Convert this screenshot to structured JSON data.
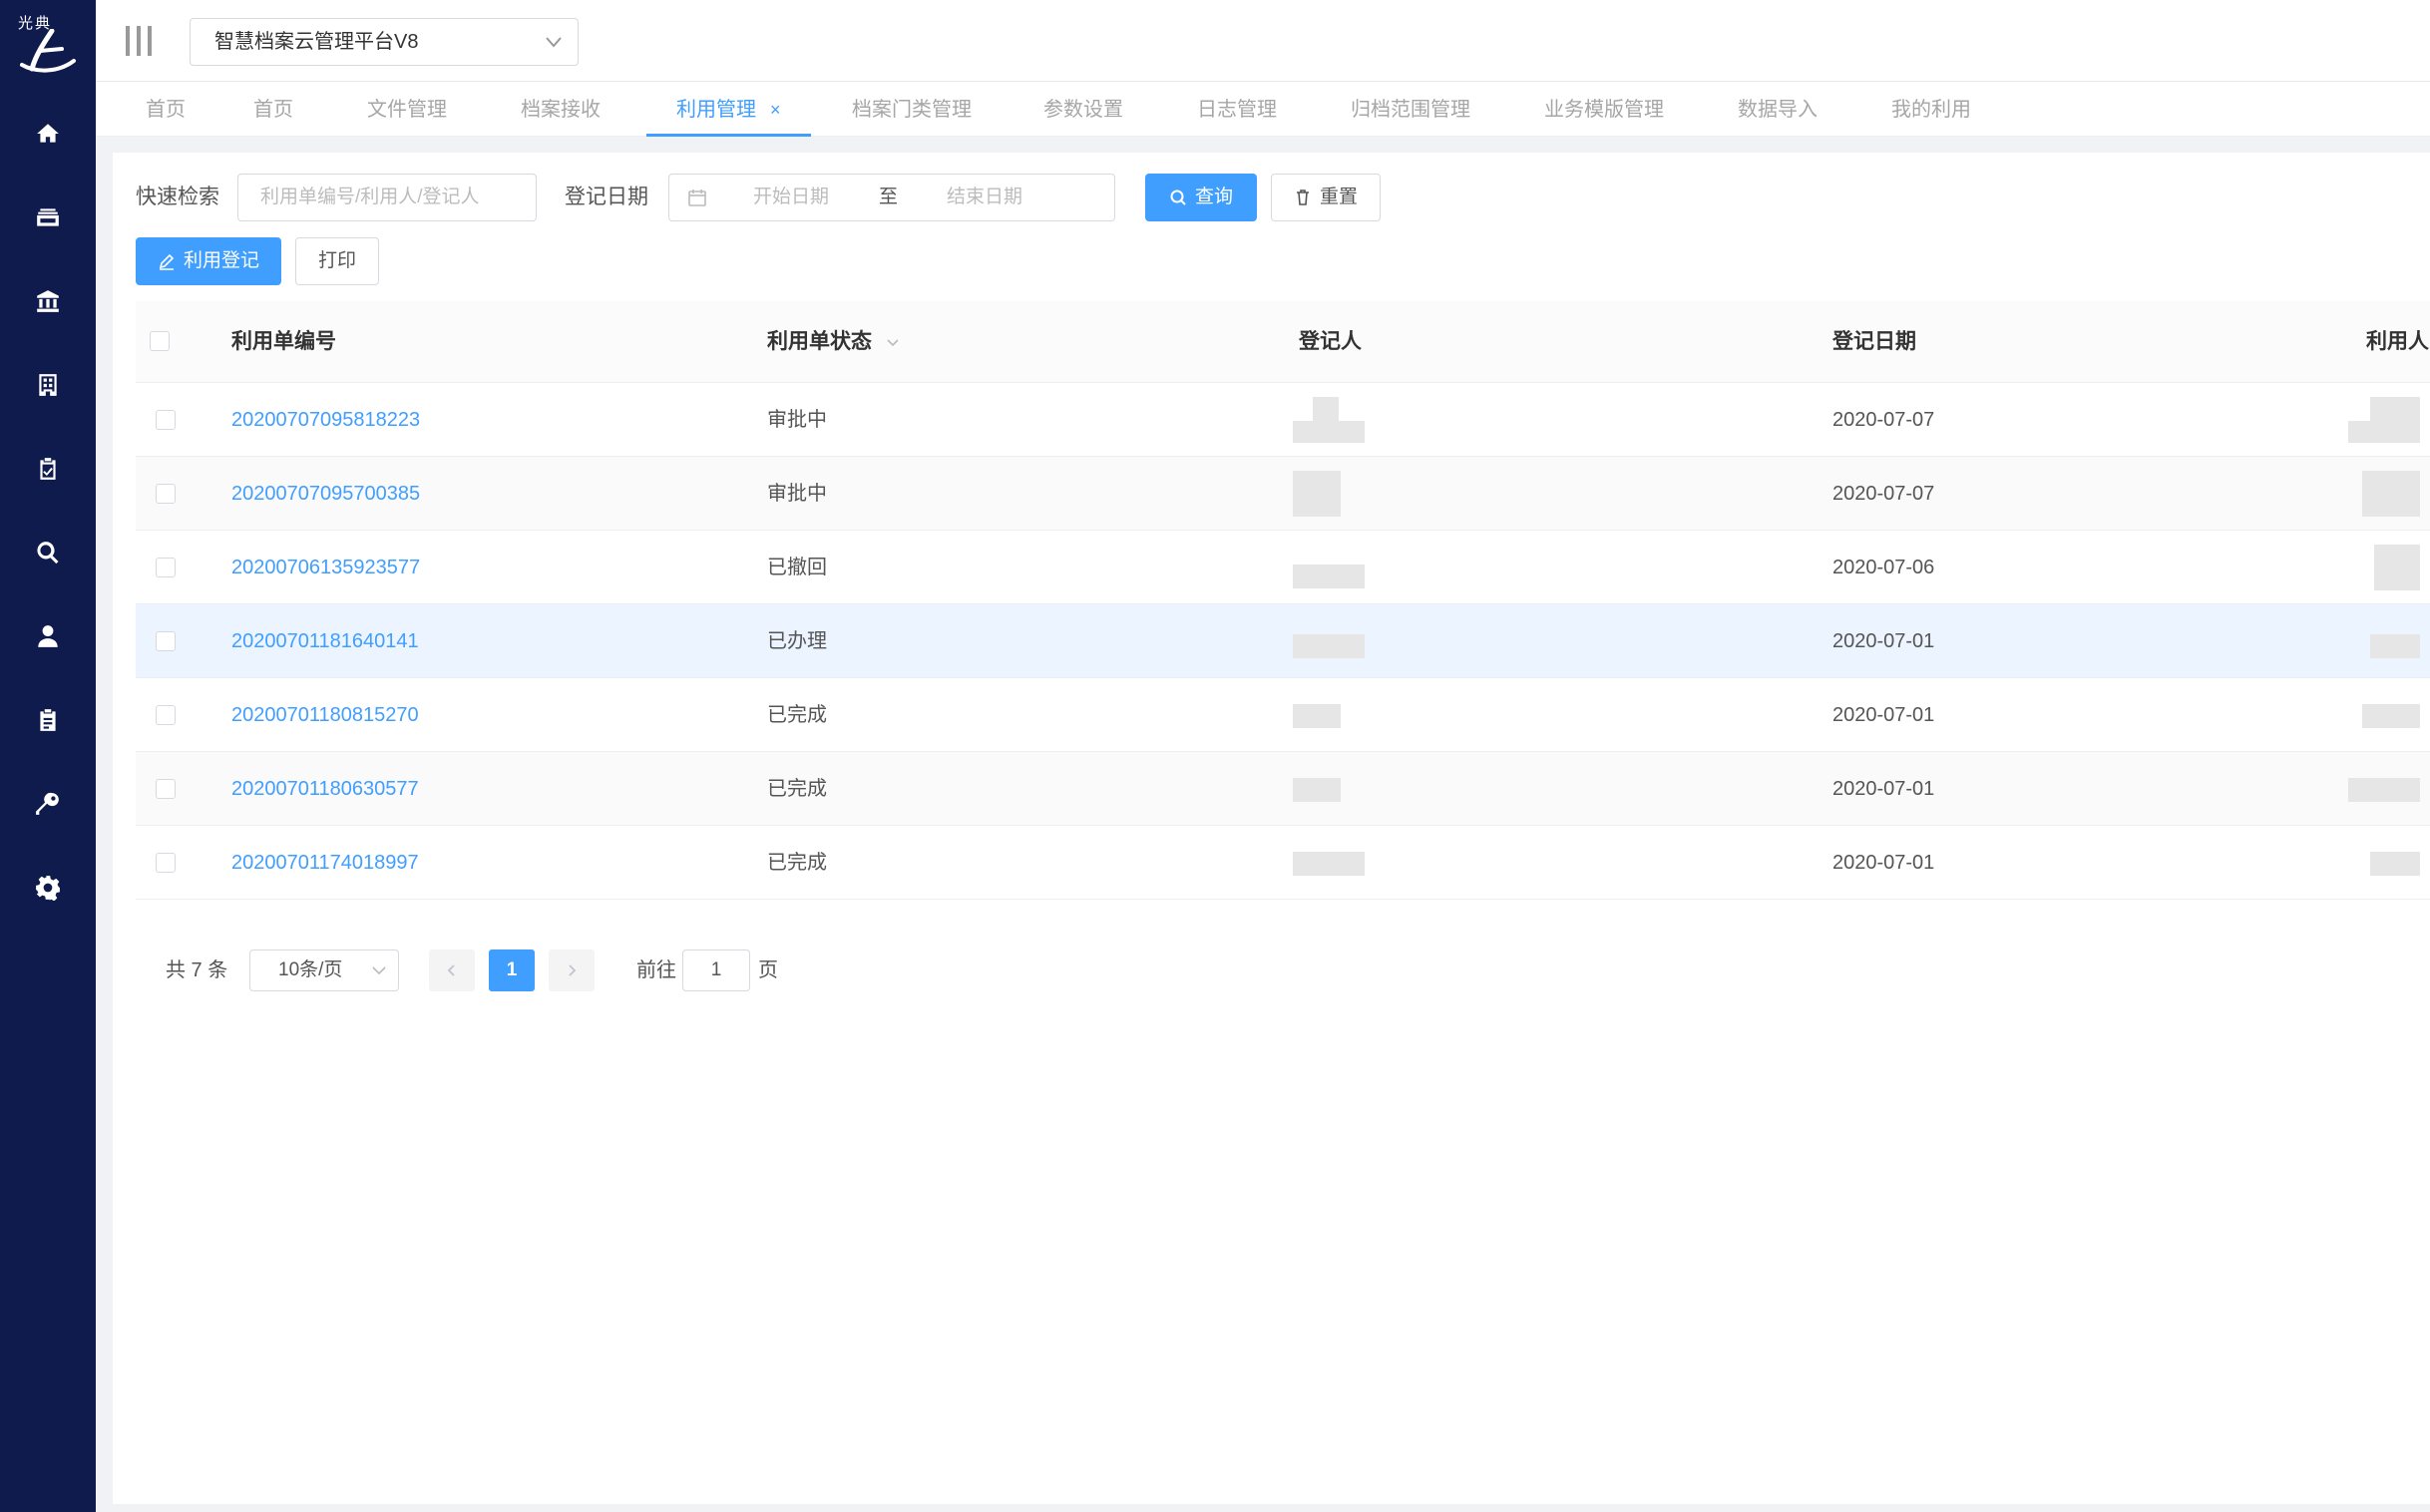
{
  "logo": {
    "text": "光典"
  },
  "header": {
    "platform_select": "智慧档案云管理平台V8"
  },
  "sidebar": {
    "items": [
      {
        "icon": "home-icon"
      },
      {
        "icon": "archive-box-icon"
      },
      {
        "icon": "bank-icon"
      },
      {
        "icon": "building-icon"
      },
      {
        "icon": "clipboard-check-icon"
      },
      {
        "icon": "search-icon"
      },
      {
        "icon": "user-icon"
      },
      {
        "icon": "clipboard-list-icon"
      },
      {
        "icon": "key-icon"
      },
      {
        "icon": "gear-icon"
      }
    ]
  },
  "tabs": [
    {
      "label": "首页"
    },
    {
      "label": "首页"
    },
    {
      "label": "文件管理"
    },
    {
      "label": "档案接收"
    },
    {
      "label": "利用管理",
      "active": true,
      "close": "×"
    },
    {
      "label": "档案门类管理"
    },
    {
      "label": "参数设置"
    },
    {
      "label": "日志管理"
    },
    {
      "label": "归档范围管理"
    },
    {
      "label": "业务模版管理"
    },
    {
      "label": "数据导入"
    },
    {
      "label": "我的利用"
    }
  ],
  "search": {
    "quick_label": "快速检索",
    "quick_placeholder": "利用单编号/利用人/登记人",
    "date_label": "登记日期",
    "start_placeholder": "开始日期",
    "separator": "至",
    "end_placeholder": "结束日期",
    "query_button": "查询",
    "reset_button": "重置"
  },
  "actions": {
    "register_button": "利用登记",
    "print_button": "打印"
  },
  "table": {
    "headers": {
      "number": "利用单编号",
      "status": "利用单状态",
      "registrar": "登记人",
      "date": "登记日期",
      "user": "利用人"
    },
    "rows": [
      {
        "number": "20200707095818223",
        "status": "审批中",
        "date": "2020-07-07"
      },
      {
        "number": "20200707095700385",
        "status": "审批中",
        "date": "2020-07-07"
      },
      {
        "number": "20200706135923577",
        "status": "已撤回",
        "date": "2020-07-06"
      },
      {
        "number": "20200701181640141",
        "status": "已办理",
        "date": "2020-07-01"
      },
      {
        "number": "20200701180815270",
        "status": "已完成",
        "date": "2020-07-01"
      },
      {
        "number": "20200701180630577",
        "status": "已完成",
        "date": "2020-07-01"
      },
      {
        "number": "20200701174018997",
        "status": "已完成",
        "date": "2020-07-01"
      }
    ]
  },
  "pagination": {
    "total_text": "共 7 条",
    "page_size": "10条/页",
    "current_page": "1",
    "goto_label": "前往",
    "goto_value": "1",
    "page_suffix": "页"
  },
  "colors": {
    "sidebar": "#0f1b4c",
    "primary": "#409eff",
    "highlight_row": "#ecf5ff"
  }
}
